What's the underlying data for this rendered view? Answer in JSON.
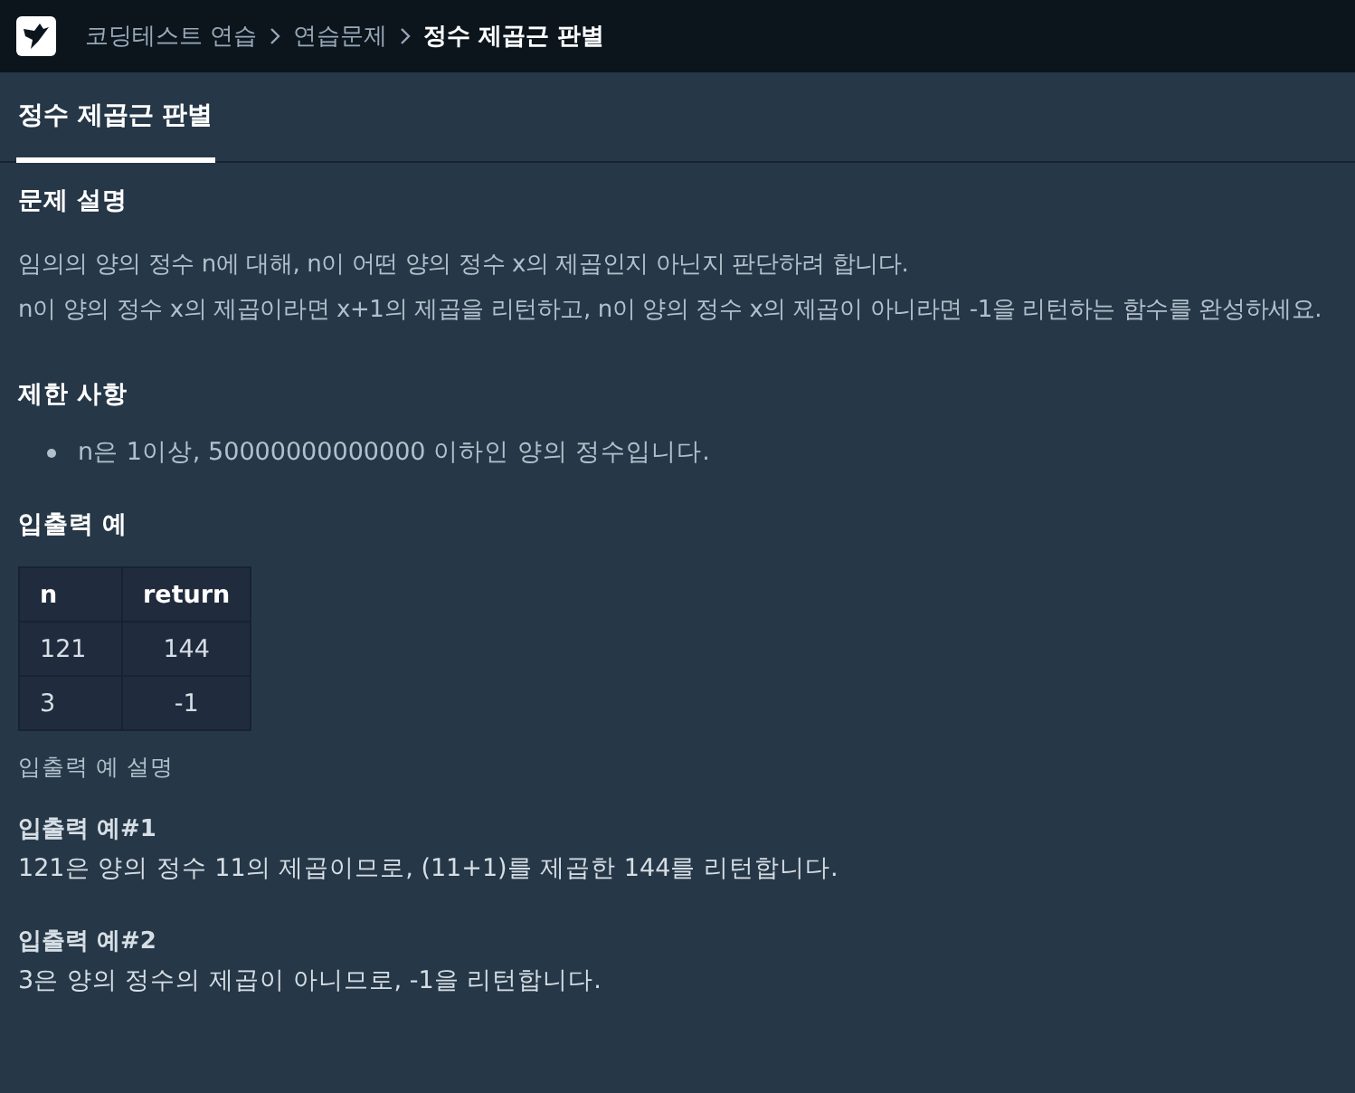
{
  "breadcrumb": [
    {
      "label": "코딩테스트 연습",
      "current": false
    },
    {
      "label": "연습문제",
      "current": false
    },
    {
      "label": "정수 제곱근 판별",
      "current": true
    }
  ],
  "tabs": [
    {
      "label": "정수 제곱근 판별",
      "selected": true
    }
  ],
  "sections": [
    {
      "kind": "heading",
      "text": "문제 설명"
    },
    {
      "kind": "paragraph",
      "lines": [
        "임의의 양의 정수 n에 대해, n이 어떤 양의 정수 x의 제곱인지 아닌지 판단하려 합니다.",
        "n이 양의 정수 x의 제곱이라면 x+1의 제곱을 리턴하고, n이 양의 정수 x의 제곱이 아니라면 -1을 리턴하는 함수를 완성하세요."
      ]
    },
    {
      "kind": "heading",
      "text": "제한 사항"
    },
    {
      "kind": "bullets",
      "items": [
        "n은 1이상, 50000000000000 이하인 양의 정수입니다."
      ]
    },
    {
      "kind": "heading",
      "text": "입출력 예"
    },
    {
      "kind": "table",
      "columns": [
        "n",
        "return"
      ],
      "rows": [
        [
          "121",
          "144"
        ],
        [
          "3",
          "-1"
        ]
      ]
    },
    {
      "kind": "caption",
      "text": "입출력 예 설명"
    },
    {
      "kind": "subheading",
      "text": "입출력 예#1"
    },
    {
      "kind": "line",
      "text": "121은 양의 정수 11의 제곱이므로, (11+1)를 제곱한 144를 리턴합니다."
    },
    {
      "kind": "subheading",
      "text": "입출력 예#2"
    },
    {
      "kind": "line",
      "text": "3은 양의 정수의 제곱이 아니므로, -1을 리턴합니다."
    }
  ]
}
